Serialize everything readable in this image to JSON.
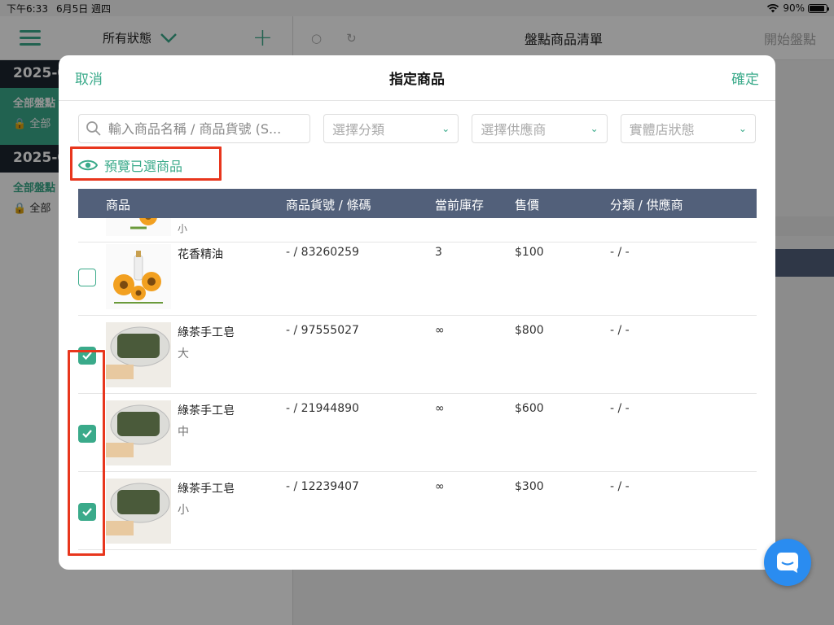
{
  "status_bar": {
    "time": "下午6:33",
    "date": "6月5日 週四",
    "battery": "90%",
    "battery_level": 0.9
  },
  "background": {
    "filter_label": "所有狀態",
    "date_header_1": "2025-0",
    "item_1_title": "全部盤點",
    "item_1_sub": "全部",
    "date_header_2": "2025-0",
    "item_2_title": "全部盤點",
    "item_2_sub": "全部",
    "right_title": "盤點商品清單",
    "start_button": "開始盤點"
  },
  "modal": {
    "cancel_label": "取消",
    "title": "指定商品",
    "confirm_label": "確定",
    "search_placeholder": "輸入商品名稱 / 商品貨號 (S...",
    "category_placeholder": "選擇分類",
    "supplier_placeholder": "選擇供應商",
    "store_status_placeholder": "實體店狀態",
    "preview_label": "預覽已選商品"
  },
  "table": {
    "headers": {
      "product": "商品",
      "sku": "商品貨號 / 條碼",
      "stock": "當前庫存",
      "price": "售價",
      "category": "分類 / 供應商"
    },
    "partial_row_text": "小",
    "rows": [
      {
        "name": "花香精油",
        "variant": "",
        "sku": "- / 83260259",
        "stock": "3",
        "price": "$100",
        "category": "- / -",
        "checked": false,
        "image": "sunflower"
      },
      {
        "name": "綠茶手工皂",
        "variant": "大",
        "sku": "- / 97555027",
        "stock": "∞",
        "price": "$800",
        "category": "- / -",
        "checked": true,
        "image": "soap"
      },
      {
        "name": "綠茶手工皂",
        "variant": "中",
        "sku": "- / 21944890",
        "stock": "∞",
        "price": "$600",
        "category": "- / -",
        "checked": true,
        "image": "soap"
      },
      {
        "name": "綠茶手工皂",
        "variant": "小",
        "sku": "- / 12239407",
        "stock": "∞",
        "price": "$300",
        "category": "- / -",
        "checked": true,
        "image": "soap"
      }
    ]
  },
  "colors": {
    "accent": "#3aaa8a",
    "header_bg": "#52607a",
    "highlight": "#e8361d",
    "chat": "#2a8cf0"
  }
}
